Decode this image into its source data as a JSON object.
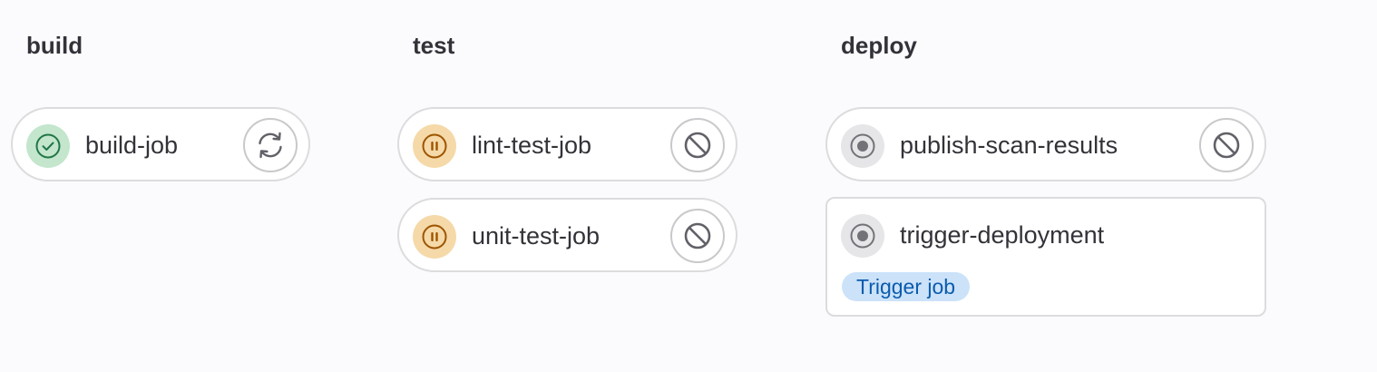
{
  "stages": [
    {
      "title": "build",
      "jobs": [
        {
          "name": "build-job",
          "status_icon": "check-circle-icon",
          "action_icon": "retry-icon"
        }
      ]
    },
    {
      "title": "test",
      "jobs": [
        {
          "name": "lint-test-job",
          "status_icon": "pause-circle-icon",
          "action_icon": "cancel-icon"
        },
        {
          "name": "unit-test-job",
          "status_icon": "pause-circle-icon",
          "action_icon": "cancel-icon"
        }
      ]
    },
    {
      "title": "deploy",
      "jobs": [
        {
          "name": "publish-scan-results",
          "status_icon": "created-circle-icon",
          "action_icon": "cancel-icon"
        },
        {
          "name": "trigger-deployment",
          "status_icon": "created-circle-icon",
          "badge": "Trigger job"
        }
      ]
    }
  ],
  "colors": {
    "background": "#fbfafd",
    "success": "#217645",
    "success_bg": "#c3e6cd",
    "manual": "#9e5400",
    "manual_bg": "#f5d9a8",
    "created": "#737278",
    "created_bg": "#e6e6e8",
    "badge_bg": "#cbe2f9",
    "badge_text": "#0b5cad"
  }
}
